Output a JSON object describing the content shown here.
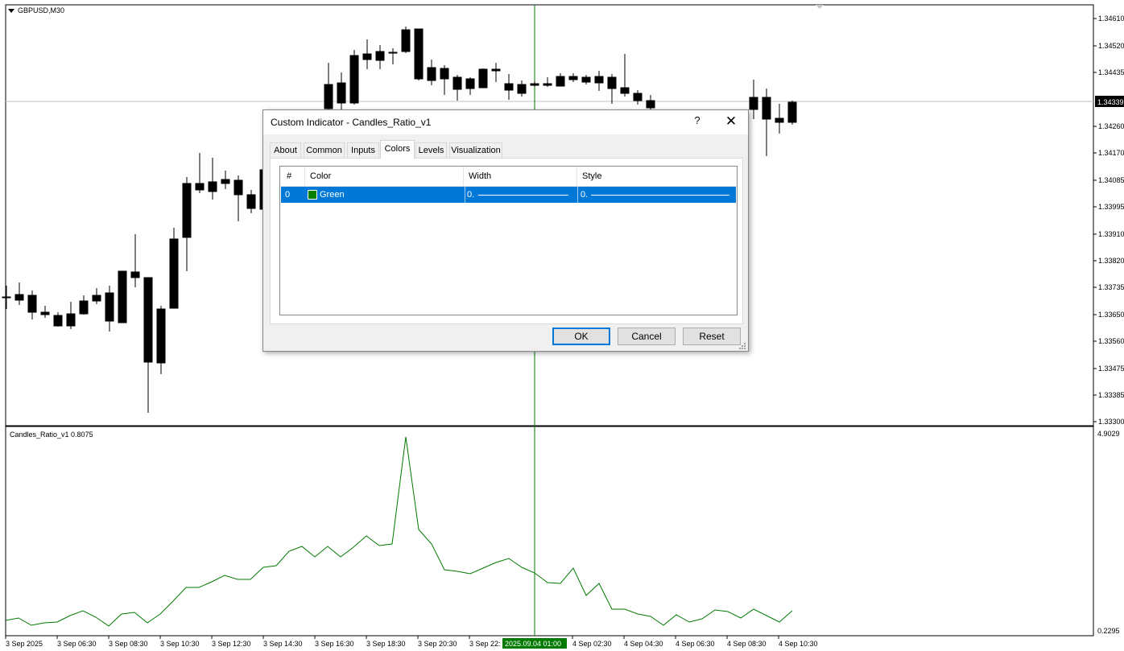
{
  "chart": {
    "symbol_label": "GBPUSD,M30",
    "indicator_label": "Candles_Ratio_v1 0.8075",
    "price_axis": [
      "1.34610",
      "1.34520",
      "1.34435",
      "1.34260",
      "1.34170",
      "1.34085",
      "1.33995",
      "1.33910",
      "1.33820",
      "1.33735",
      "1.33650",
      "1.33560",
      "1.33475",
      "1.33385",
      "1.33300"
    ],
    "current_price_tag": "1.34339",
    "indicator_axis": {
      "max": "4.9029",
      "min": "0.2295"
    },
    "time_axis": [
      "3 Sep 2025",
      "3 Sep 06:30",
      "3 Sep 08:30",
      "3 Sep 10:30",
      "3 Sep 12:30",
      "3 Sep 14:30",
      "3 Sep 16:30",
      "3 Sep 18:30",
      "3 Sep 20:30",
      "3 Sep 22:",
      "4 Sep 02:30",
      "4 Sep 04:30",
      "4 Sep 06:30",
      "4 Sep 08:30",
      "4 Sep 10:30"
    ],
    "crosshair_time": "2025.09.04 01:00",
    "colors": {
      "indicator_line": "#007a00",
      "crosshair": "#007a00",
      "bull_fill": "#ffffff",
      "bear_fill": "#000000"
    }
  },
  "dialog": {
    "title": "Custom Indicator - Candles_Ratio_v1",
    "help_label": "?",
    "close_label": "✕",
    "tabs": [
      {
        "label": "About",
        "active": false
      },
      {
        "label": "Common",
        "active": false
      },
      {
        "label": "Inputs",
        "active": false
      },
      {
        "label": "Colors",
        "active": true
      },
      {
        "label": "Levels",
        "active": false
      },
      {
        "label": "Visualization",
        "active": false
      }
    ],
    "grid": {
      "headers": [
        "#",
        "Color",
        "Width",
        "Style"
      ],
      "rows": [
        {
          "index": "0",
          "color_name": "Green",
          "color_swatch": "#008000",
          "width": "0.",
          "style": "0."
        }
      ]
    },
    "buttons": {
      "ok": "OK",
      "cancel": "Cancel",
      "reset": "Reset"
    }
  }
}
